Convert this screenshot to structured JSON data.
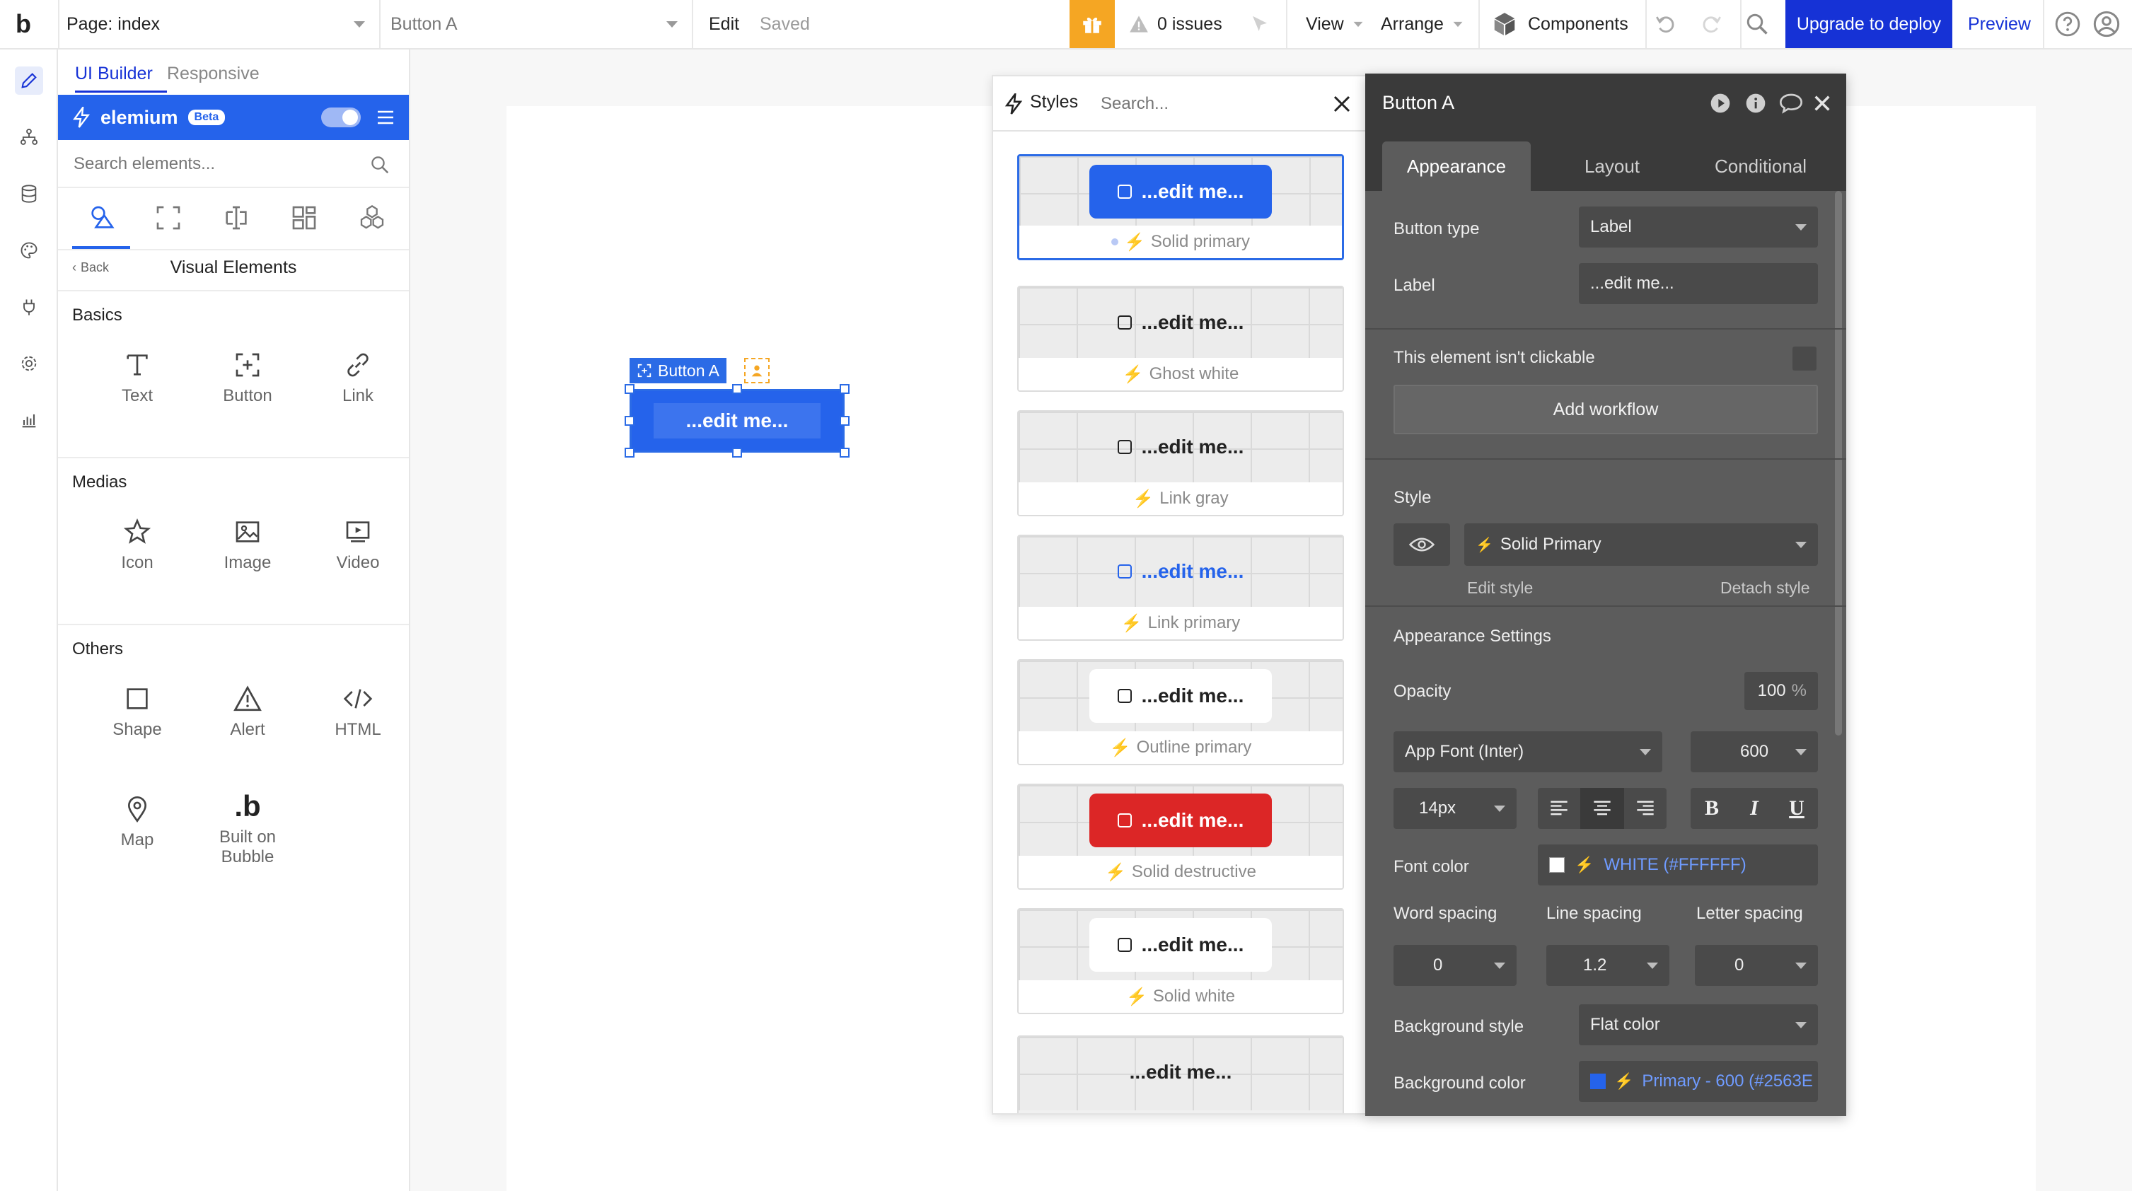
{
  "topbar": {
    "logo": "b",
    "page_select": "Page: index",
    "element_select": "Button A",
    "edit": "Edit",
    "saved": "Saved",
    "issues": "0 issues",
    "view": "View",
    "arrange": "Arrange",
    "components": "Components",
    "upgrade": "Upgrade to deploy",
    "preview": "Preview"
  },
  "panel": {
    "tab_ui_builder": "UI Builder",
    "tab_responsive": "Responsive",
    "plugin_name": "elemium",
    "plugin_badge": "Beta",
    "search_placeholder": "Search elements...",
    "back": "Back",
    "title": "Visual Elements",
    "basics_title": "Basics",
    "basics": [
      "Text",
      "Button",
      "Link"
    ],
    "medias_title": "Medias",
    "medias": [
      "Icon",
      "Image",
      "Video"
    ],
    "others_title": "Others",
    "others": [
      "Shape",
      "Alert",
      "HTML",
      "Map"
    ],
    "built_on_bubble_line1": "Built on",
    "built_on_bubble_line2": "Bubble"
  },
  "canvas": {
    "selection_label": "Button A",
    "button_text": "...edit me..."
  },
  "styles": {
    "title": "Styles",
    "search_placeholder": "Search...",
    "cards": [
      {
        "text": "...edit me...",
        "caption": "Solid primary"
      },
      {
        "text": "...edit me...",
        "caption": "Ghost white"
      },
      {
        "text": "...edit me...",
        "caption": "Link gray"
      },
      {
        "text": "...edit me...",
        "caption": "Link primary"
      },
      {
        "text": "...edit me...",
        "caption": "Outline primary"
      },
      {
        "text": "...edit me...",
        "caption": "Solid destructive"
      },
      {
        "text": "...edit me...",
        "caption": "Solid white"
      },
      {
        "text": "...edit me..."
      }
    ]
  },
  "props": {
    "title": "Button A",
    "tabs": [
      "Appearance",
      "Layout",
      "Conditional"
    ],
    "button_type_label": "Button type",
    "button_type_value": "Label",
    "label_label": "Label",
    "label_value": "...edit me...",
    "not_clickable": "This element isn't clickable",
    "add_workflow": "Add workflow",
    "style_label": "Style",
    "style_value": "Solid Primary",
    "edit_style": "Edit style",
    "detach_style": "Detach style",
    "appearance_settings": "Appearance Settings",
    "opacity_label": "Opacity",
    "opacity_value": "100",
    "opacity_unit": "%",
    "font_value": "App Font (Inter)",
    "font_weight": "600",
    "font_size": "14px",
    "bold": "B",
    "italic": "I",
    "underline": "U",
    "font_color_label": "Font color",
    "font_color_value": "WHITE (#FFFFFF)",
    "word_spacing_label": "Word spacing",
    "line_spacing_label": "Line spacing",
    "letter_spacing_label": "Letter spacing",
    "word_spacing_value": "0",
    "line_spacing_value": "1.2",
    "letter_spacing_value": "0",
    "bg_style_label": "Background style",
    "bg_style_value": "Flat color",
    "bg_color_label": "Background color",
    "bg_color_value": "Primary - 600 (#2563E"
  },
  "colors": {
    "primary": "#2563EB",
    "upgrade": "#1632D6",
    "destructive": "#DC2626",
    "gift": "#F5A623"
  }
}
